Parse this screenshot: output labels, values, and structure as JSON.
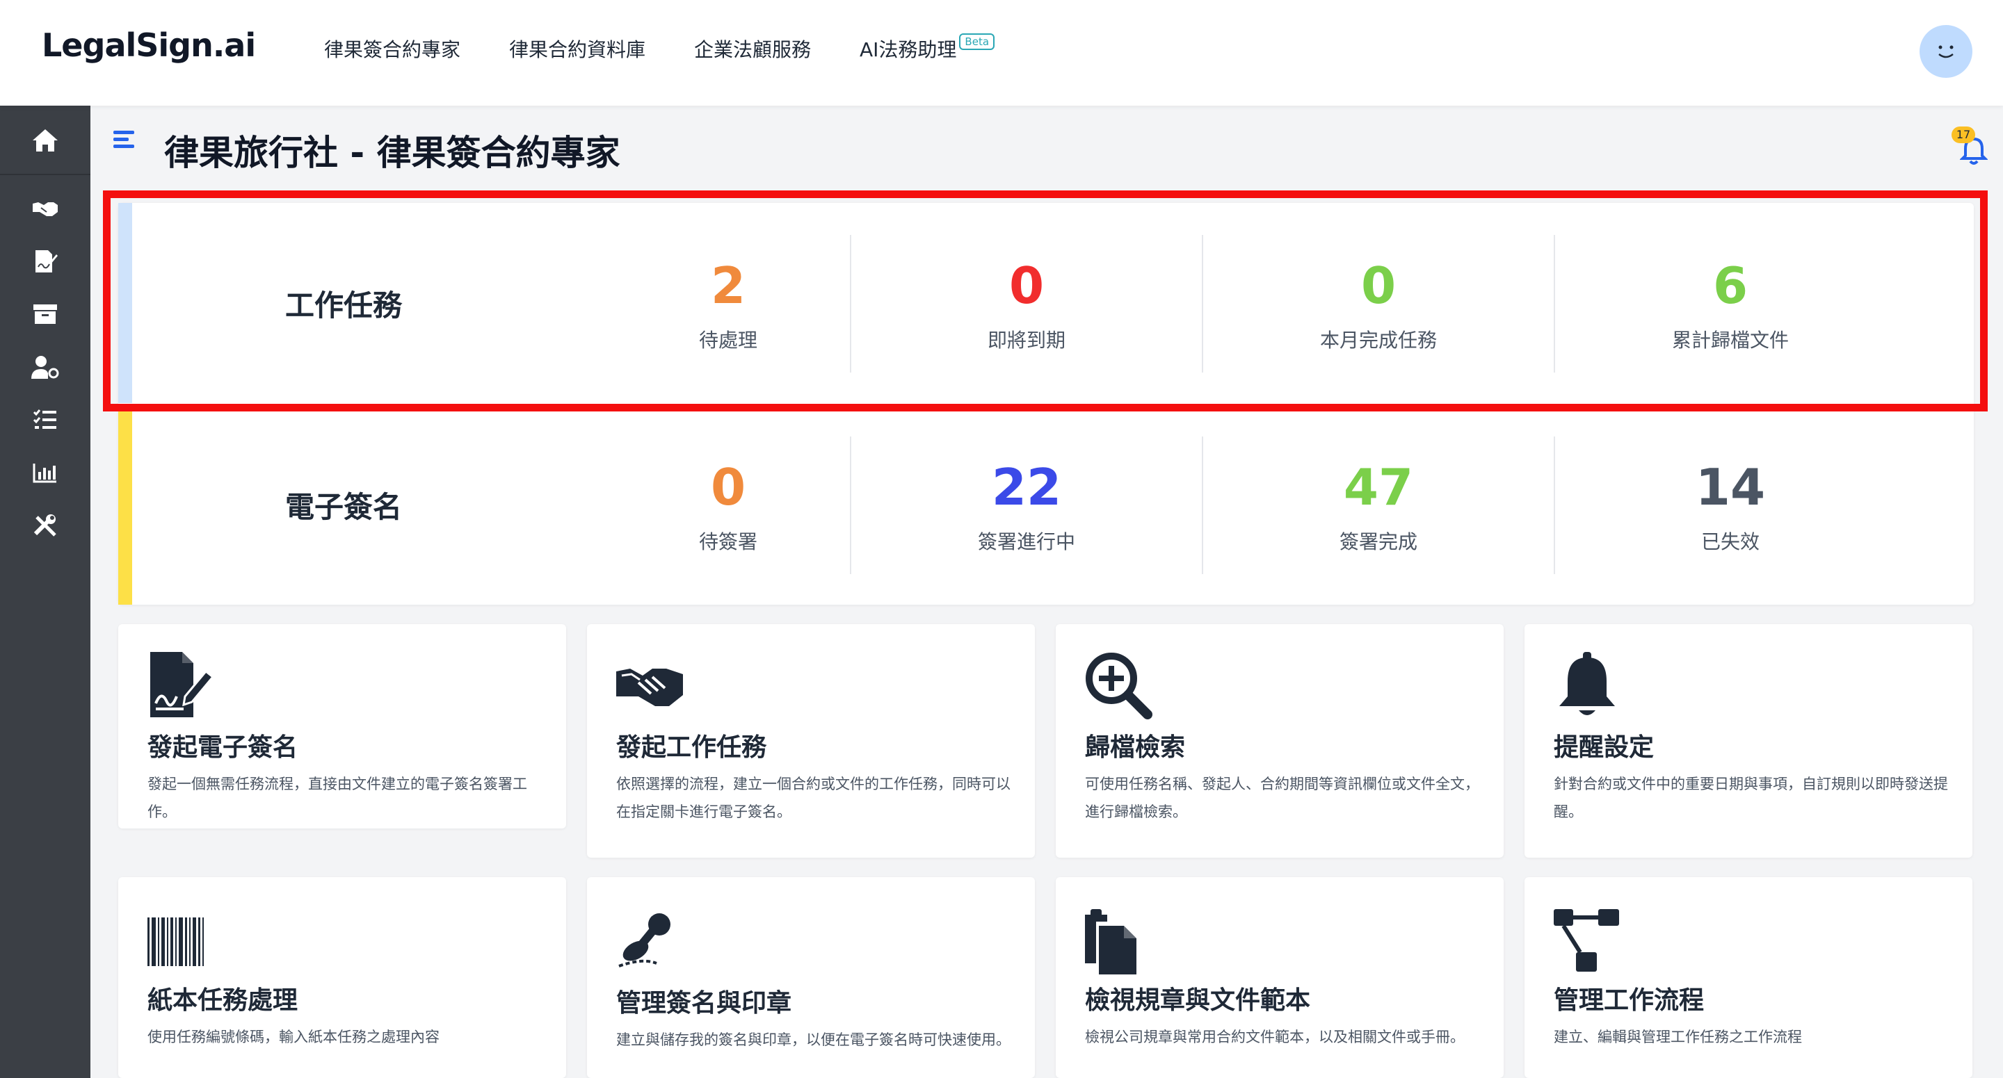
{
  "app": {
    "logo": "LegalSign.ai"
  },
  "nav": {
    "items": [
      {
        "label": "律果簽合約專家"
      },
      {
        "label": "律果合約資料庫"
      },
      {
        "label": "企業法顧服務"
      },
      {
        "label": "AI法務助理",
        "badge": "Beta"
      }
    ]
  },
  "sidebar": {
    "icons": [
      "home-icon",
      "handshake-icon",
      "signature-icon",
      "archive-icon",
      "user-settings-icon",
      "task-list-icon",
      "chart-icon",
      "tools-icon"
    ]
  },
  "header": {
    "title": "律果旅行社 - 律果簽合約專家",
    "notification_count": "17"
  },
  "stats": {
    "work_tasks": {
      "label": "工作任務",
      "accent": "#cfe3fb",
      "items": [
        {
          "value": "2",
          "label": "待處理",
          "color": "#f08a3c"
        },
        {
          "value": "0",
          "label": "即將到期",
          "color": "#f12d2d"
        },
        {
          "value": "0",
          "label": "本月完成任務",
          "color": "#7bcf4a"
        },
        {
          "value": "6",
          "label": "累計歸檔文件",
          "color": "#7bcf4a"
        }
      ]
    },
    "e_signature": {
      "label": "電子簽名",
      "accent": "#fde047",
      "items": [
        {
          "value": "0",
          "label": "待簽署",
          "color": "#f08a3c"
        },
        {
          "value": "22",
          "label": "簽署進行中",
          "color": "#3b4ae8"
        },
        {
          "value": "47",
          "label": "簽署完成",
          "color": "#7bcf4a"
        },
        {
          "value": "14",
          "label": "已失效",
          "color": "#4b5563"
        }
      ]
    }
  },
  "cards": [
    {
      "icon": "signature-document-icon",
      "title": "發起電子簽名",
      "desc": "發起一個無需任務流程，直接由文件建立的電子簽名簽署工作。"
    },
    {
      "icon": "handshake-icon",
      "title": "發起工作任務",
      "desc": "依照選擇的流程，建立一個合約或文件的工作任務，同時可以在指定關卡進行電子簽名。"
    },
    {
      "icon": "search-plus-icon",
      "title": "歸檔檢索",
      "desc": "可使用任務名稱、發起人、合約期間等資訊欄位或文件全文，進行歸檔檢索。"
    },
    {
      "icon": "bell-icon",
      "title": "提醒設定",
      "desc": "針對合約或文件中的重要日期與事項，自訂規則以即時發送提醒。"
    },
    {
      "icon": "barcode-icon",
      "title": "紙本任務處理",
      "desc": "使用任務編號條碼，輸入紙本任務之處理內容"
    },
    {
      "icon": "stamp-icon",
      "title": "管理簽名與印章",
      "desc": "建立與儲存我的簽名與印章，以便在電子簽名時可快速使用。"
    },
    {
      "icon": "documents-icon",
      "title": "檢視規章與文件範本",
      "desc": "檢視公司規章與常用合約文件範本，以及相關文件或手冊。"
    },
    {
      "icon": "workflow-icon",
      "title": "管理工作流程",
      "desc": "建立、編輯與管理工作任務之工作流程"
    }
  ]
}
